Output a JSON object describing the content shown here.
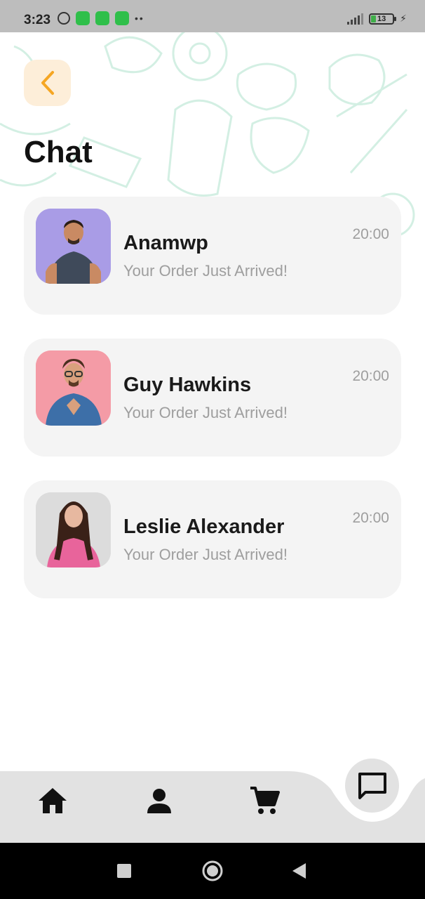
{
  "status_bar": {
    "time": "3:23",
    "battery_level": "13",
    "icons": [
      "alarm-icon",
      "app-badge-icon",
      "app-badge-icon",
      "app-badge-icon",
      "more-dots-icon",
      "signal-icon",
      "battery-icon",
      "charging-icon"
    ]
  },
  "header": {
    "back_icon": "chevron-left-icon",
    "title": "Chat"
  },
  "chats": [
    {
      "name": "Anamwp",
      "message": "Your Order Just Arrived!",
      "time": "20:00",
      "avatar_bg": "#a99ce6"
    },
    {
      "name": "Guy Hawkins",
      "message": "Your Order Just Arrived!",
      "time": "20:00",
      "avatar_bg": "#f49ba6"
    },
    {
      "name": "Leslie Alexander",
      "message": "Your Order Just Arrived!",
      "time": "20:00",
      "avatar_bg": "#dcdcdc"
    }
  ],
  "bottom_nav": {
    "items": [
      "home-icon",
      "profile-icon",
      "cart-icon"
    ],
    "active": "chat-icon"
  },
  "colors": {
    "accent": "#f5a623",
    "back_button_bg": "#fdeed9",
    "card_bg": "#f4f4f4",
    "nav_bg": "#e2e2e2",
    "doodle": "#cfeee1"
  }
}
